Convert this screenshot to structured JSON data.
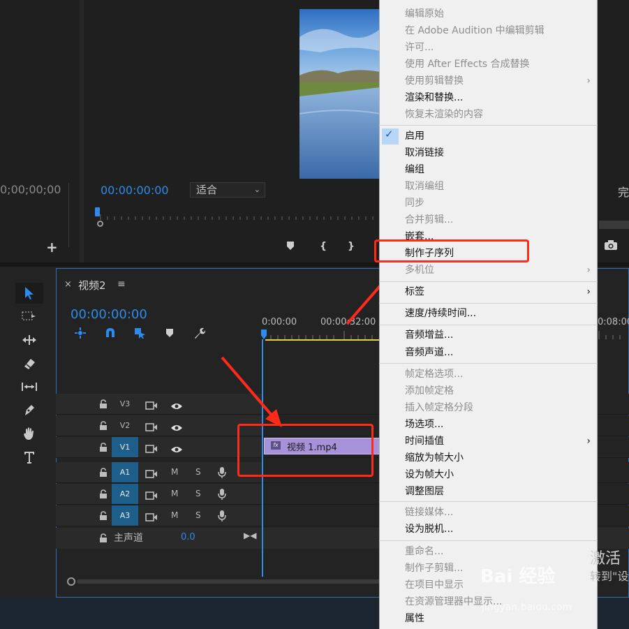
{
  "source_monitor": {
    "timecode": "0;00;00;00",
    "add_button": "+"
  },
  "program_monitor": {
    "timecode": "00:00:00:00",
    "fit_select": "适合",
    "right_label": "完",
    "controls": [
      "marker",
      "in-point",
      "out-point",
      "camera"
    ]
  },
  "timeline": {
    "close": "×",
    "sequence_name": "视频2",
    "menu": "≡",
    "timecode": "00:00:00:00",
    "ruler": [
      "0:00:00",
      "00:00:32:00",
      "0:08:00"
    ],
    "tracks": [
      {
        "name": "V3",
        "type": "video",
        "targeted": false
      },
      {
        "name": "V2",
        "type": "video",
        "targeted": false
      },
      {
        "name": "V1",
        "type": "video",
        "targeted": true
      },
      {
        "name": "A1",
        "type": "audio",
        "targeted": true
      },
      {
        "name": "A2",
        "type": "audio",
        "targeted": true
      },
      {
        "name": "A3",
        "type": "audio",
        "targeted": true
      }
    ],
    "audio_labels": {
      "mute": "M",
      "solo": "S"
    },
    "master": {
      "label": "主声道",
      "value": "0.0"
    },
    "clip": {
      "fx": "fx",
      "name": "视频 1.mp4"
    }
  },
  "context_menu": {
    "items": [
      {
        "label": "编辑原始",
        "enabled": false
      },
      {
        "label": "在 Adobe Audition 中编辑剪辑",
        "enabled": false
      },
      {
        "label": "许可...",
        "enabled": false
      },
      {
        "label": "使用 After Effects 合成替换",
        "enabled": false
      },
      {
        "label": "使用剪辑替换",
        "enabled": false,
        "submenu": true
      },
      {
        "label": "渲染和替换...",
        "enabled": true
      },
      {
        "label": "恢复未渲染的内容",
        "enabled": false
      },
      {
        "label": "启用",
        "enabled": true,
        "checked": true
      },
      {
        "label": "取消链接",
        "enabled": true
      },
      {
        "label": "编组",
        "enabled": true
      },
      {
        "label": "取消编组",
        "enabled": false
      },
      {
        "label": "同步",
        "enabled": false
      },
      {
        "label": "合并剪辑...",
        "enabled": false
      },
      {
        "label": "嵌套...",
        "enabled": true
      },
      {
        "label": "制作子序列",
        "enabled": true,
        "highlighted": true
      },
      {
        "label": "多机位",
        "enabled": false,
        "submenu": true
      },
      {
        "label": "标签",
        "enabled": true,
        "submenu": true
      },
      {
        "label": "速度/持续时间...",
        "enabled": true
      },
      {
        "label": "音频增益...",
        "enabled": true
      },
      {
        "label": "音频声道...",
        "enabled": true
      },
      {
        "label": "帧定格选项...",
        "enabled": false
      },
      {
        "label": "添加帧定格",
        "enabled": false
      },
      {
        "label": "插入帧定格分段",
        "enabled": false
      },
      {
        "label": "场选项...",
        "enabled": true
      },
      {
        "label": "时间插值",
        "enabled": true,
        "submenu": true
      },
      {
        "label": "缩放为帧大小",
        "enabled": true
      },
      {
        "label": "设为帧大小",
        "enabled": true
      },
      {
        "label": "调整图层",
        "enabled": true
      },
      {
        "label": "链接媒体...",
        "enabled": false
      },
      {
        "label": "设为脱机...",
        "enabled": true
      },
      {
        "label": "重命名...",
        "enabled": false
      },
      {
        "label": "制作子剪辑...",
        "enabled": false
      },
      {
        "label": "在项目中显示",
        "enabled": false
      },
      {
        "label": "在资源管理器中显示...",
        "enabled": false
      },
      {
        "label": "属性",
        "enabled": true
      }
    ]
  },
  "watermark": {
    "line1": "激活",
    "line2": "转到\"设",
    "logo": "Bai  经验",
    "url": "jingyan.baidu.com"
  },
  "colors": {
    "accent": "#2d8ceb",
    "annotation": "#ff2a1a",
    "clip": "#a791d8",
    "menu_bg": "#f0f0f0"
  }
}
